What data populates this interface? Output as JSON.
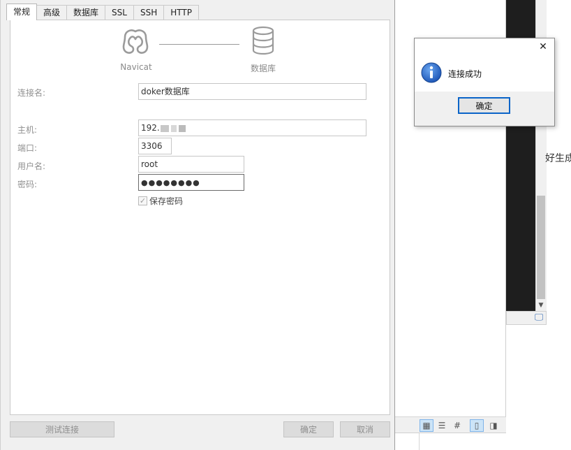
{
  "tabs": [
    {
      "label": "常规",
      "active": true
    },
    {
      "label": "高级",
      "active": false
    },
    {
      "label": "数据库",
      "active": false
    },
    {
      "label": "SSL",
      "active": false
    },
    {
      "label": "SSH",
      "active": false
    },
    {
      "label": "HTTP",
      "active": false
    }
  ],
  "diagram": {
    "left_label": "Navicat",
    "right_label": "数据库"
  },
  "form": {
    "connection_name_label": "连接名:",
    "connection_name_value": "doker数据库",
    "host_label": "主机:",
    "host_value": "192.",
    "port_label": "端口:",
    "port_value": "3306",
    "username_label": "用户名:",
    "username_value": "root",
    "password_label": "密码:",
    "password_mask": "●●●●●●●●",
    "save_password_label": "保存密码",
    "save_password_checked": true
  },
  "footer": {
    "test_connection_label": "测试连接",
    "ok_label": "确定",
    "cancel_label": "取消"
  },
  "message_box": {
    "text": "连接成功",
    "ok_label": "确定",
    "icon": "info-icon"
  },
  "background": {
    "side_text": "好生成"
  },
  "colors": {
    "accent": "#0a64c8",
    "info_icon": "#1f58b8"
  }
}
